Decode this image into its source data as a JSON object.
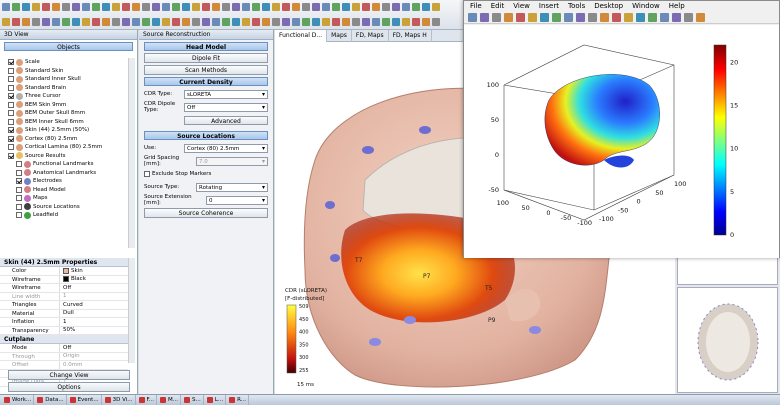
{
  "left_panel": {
    "title": "3D View",
    "objects_button": "Objects",
    "tree": [
      {
        "label": "Scale",
        "checked": true,
        "color": "#d9a07a"
      },
      {
        "label": "Standard Skin",
        "checked": false,
        "color": "#d9a07a"
      },
      {
        "label": "Standard Inner Skull",
        "checked": false,
        "color": "#d9a07a"
      },
      {
        "label": "Standard Brain",
        "checked": false,
        "color": "#d9a07a"
      },
      {
        "label": "Three Cursor",
        "checked": true,
        "color": "#b0b0b0"
      },
      {
        "label": "BEM Skin 9mm",
        "checked": false,
        "color": "#d9a07a"
      },
      {
        "label": "BEM Outer Skull 8mm",
        "checked": false,
        "color": "#d9a07a"
      },
      {
        "label": "BEM Inner Skull 6mm",
        "checked": false,
        "color": "#d9a07a"
      },
      {
        "label": "Skin (44) 2.5mm (50%)",
        "checked": true,
        "color": "#d9a07a"
      },
      {
        "label": "Cortex (80) 2.5mm",
        "checked": true,
        "color": "#d9a07a"
      },
      {
        "label": "Cortical Lamina (80) 2.5mm",
        "checked": false,
        "color": "#d9a07a"
      },
      {
        "label": "Source Results",
        "checked": true,
        "color": "#e8c060"
      },
      {
        "label": "Functional Landmarks",
        "checked": false,
        "color": "#d08080"
      },
      {
        "label": "Anatomical Landmarks",
        "checked": false,
        "color": "#d08080"
      },
      {
        "label": "Electrodes",
        "checked": true,
        "color": "#7080c0"
      },
      {
        "label": "Head Model",
        "checked": false,
        "color": "#d08080"
      },
      {
        "label": "Maps",
        "checked": false,
        "color": "#c070c0"
      },
      {
        "label": "Source Locations",
        "checked": false,
        "color": "#404040"
      },
      {
        "label": "Leadfield",
        "checked": false,
        "color": "#40a040"
      }
    ],
    "properties_title": "Skin (44) 2.5mm Properties",
    "properties": [
      {
        "key": "Color",
        "value": "Skin",
        "swatch": "#e8b8a0",
        "dim": false
      },
      {
        "key": "Wireframe",
        "value": "Black",
        "swatch": "#000000",
        "dim": false
      },
      {
        "key": "Wireframe",
        "value": "Off",
        "dim": false
      },
      {
        "key": "Line width",
        "value": "1",
        "dim": true
      },
      {
        "key": "Triangles",
        "value": "Curved",
        "dim": false
      },
      {
        "key": "Material",
        "value": "Dull",
        "dim": false
      },
      {
        "key": "Inflation",
        "value": "1",
        "dim": false
      },
      {
        "key": "Transparency",
        "value": "50%",
        "dim": false
      }
    ],
    "cutplane_title": "Cutplane",
    "cutplane": [
      {
        "key": "Mode",
        "value": "Off",
        "dim": false
      },
      {
        "key": "Through",
        "value": "Origin",
        "dim": true
      },
      {
        "key": "Offset",
        "value": "0.0mm",
        "dim": true
      },
      {
        "key": "Flip",
        "value": "On (Top)",
        "dim": true
      },
      {
        "key": "Image Data",
        "value": "1",
        "dim": true
      }
    ],
    "change_view_button": "Change View",
    "options_button": "Options"
  },
  "source_panel": {
    "title": "Source Reconstruction",
    "head_model_section": "Head Model",
    "dipole_fit_button": "Dipole Fit",
    "scan_methods_button": "Scan Methods",
    "current_density_section": "Current Density",
    "cdr_type_label": "CDR Type:",
    "cdr_type_value": "sLORETA",
    "cdr_dipole_label": "CDR Dipole Type:",
    "cdr_dipole_value": "Off",
    "advanced_button": "Advanced",
    "source_locations_section": "Source Locations",
    "use_label": "Use:",
    "use_value": "Cortex (80) 2.5mm",
    "grid_spacing_label": "Grid Spacing [mm]:",
    "grid_spacing_value": "7.0",
    "exclude_stop_label": "Exclude Stop Markers",
    "source_type_label": "Source Type:",
    "source_type_value": "Rotating",
    "source_extension_label": "Source Extension [mm]:",
    "source_extension_value": "0",
    "source_coherence_button": "Source Coherence"
  },
  "tabs": [
    "Functional D...",
    "Maps",
    "FD, Maps",
    "FD, Maps H"
  ],
  "viewport": {
    "electrodes": [
      "T7",
      "P7",
      "T5",
      "P9"
    ],
    "colorbar_title": "CDR (sLORETA)",
    "colorbar_subtitle": "[F-distributed]",
    "colorbar_ticks": [
      "509",
      "450",
      "400",
      "350",
      "300",
      "255"
    ],
    "time_label": "15 ms"
  },
  "matlab": {
    "menu": [
      "File",
      "Edit",
      "View",
      "Insert",
      "Tools",
      "Desktop",
      "Window",
      "Help"
    ],
    "chart_data": {
      "type": "heatmap",
      "title": "",
      "axes_x_ticks": [
        "-100",
        "-50",
        "0",
        "50",
        "100"
      ],
      "axes_y_ticks": [
        "-100",
        "-50",
        "0",
        "50",
        "100"
      ],
      "axes_z_ticks": [
        "-50",
        "0",
        "50",
        "100"
      ],
      "colorbar_ticks": [
        "0",
        "5",
        "10",
        "15",
        "20"
      ],
      "colorbar_range": [
        0,
        22
      ]
    }
  },
  "taskbar": [
    "Work...",
    "Data...",
    "Event...",
    "3D Vi...",
    "F...",
    "M...",
    "S...",
    "L...",
    "R..."
  ]
}
